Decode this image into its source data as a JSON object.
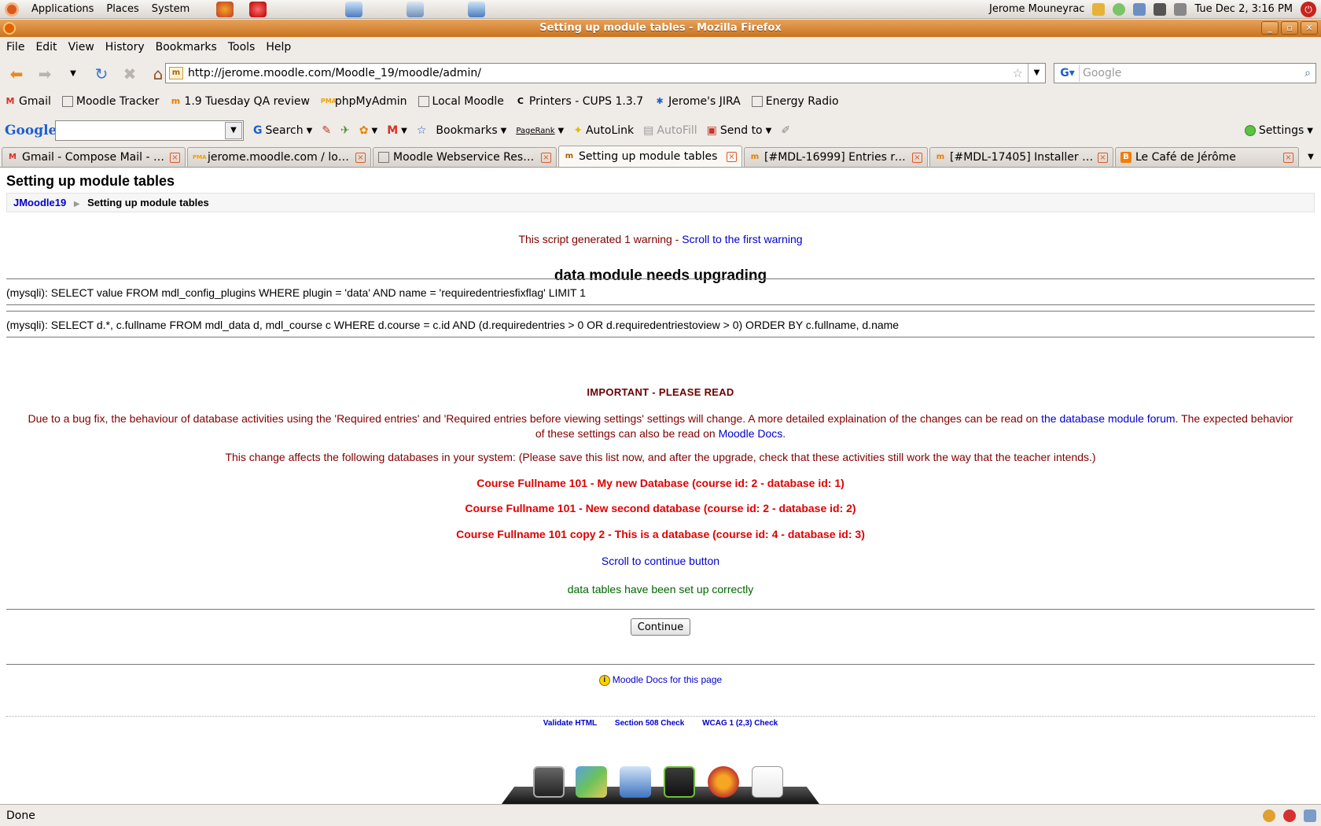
{
  "panel": {
    "menus": [
      "Applications",
      "Places",
      "System"
    ],
    "user": "Jerome Mouneyrac",
    "datetime": "Tue Dec  2,  3:16 PM"
  },
  "window": {
    "title": "Setting up module tables - Mozilla Firefox"
  },
  "menubar": [
    "File",
    "Edit",
    "View",
    "History",
    "Bookmarks",
    "Tools",
    "Help"
  ],
  "navigation": {
    "url": "http://jerome.moodle.com/Moodle_19/moodle/admin/",
    "search_placeholder": "Google"
  },
  "bookmarks": [
    "Gmail",
    "Moodle Tracker",
    "1.9 Tuesday QA review",
    "phpMyAdmin",
    "Local Moodle",
    "Printers - CUPS 1.3.7",
    "Jerome's JIRA",
    "Energy Radio"
  ],
  "google_toolbar": {
    "logo": "Google",
    "search_label": "Search",
    "bookmarks_label": "Bookmarks",
    "pagerank_label": "PageRank",
    "autolink_label": "AutoLink",
    "autofill_label": "AutoFill",
    "sendto_label": "Send to",
    "settings_label": "Settings"
  },
  "tabs": [
    {
      "label": "Gmail - Compose Mail - m...",
      "active": false
    },
    {
      "label": "jerome.moodle.com / local...",
      "active": false
    },
    {
      "label": "Moodle Webservice Rest T...",
      "active": false
    },
    {
      "label": "Setting up module tables",
      "active": true
    },
    {
      "label": "[#MDL-16999] Entries req...",
      "active": false
    },
    {
      "label": "[#MDL-17405] Installer br...",
      "active": false
    },
    {
      "label": "Le Café de Jérôme",
      "active": false
    }
  ],
  "page": {
    "heading": "Setting up module tables",
    "breadcrumb": {
      "root": "JMoodle19",
      "current": "Setting up module tables"
    },
    "warning_text": "This script generated 1 warning - ",
    "warning_link": "Scroll to the first warning",
    "upgrade_title": "data module needs upgrading",
    "sql": [
      "(mysqli): SELECT value FROM mdl_config_plugins WHERE plugin = 'data' AND name = 'requiredentriesfixflag' LIMIT 1",
      "(mysqli): SELECT d.*, c.fullname FROM mdl_data d, mdl_course c WHERE d.course = c.id AND (d.requiredentries > 0 OR d.requiredentriestoview > 0) ORDER BY c.fullname, d.name"
    ],
    "important": "IMPORTANT - PLEASE READ",
    "note_part1": "Due to a bug fix, the behaviour of database activities using the 'Required entries' and 'Required entries before viewing settings' settings will change. A more detailed explaination of the changes can be read on ",
    "note_link1": "the database module forum",
    "note_part2": ". The expected behavior of these settings can also be read on ",
    "note_link2": "Moodle Docs",
    "note_part3": ".",
    "affects": "This change affects the following databases in your system: (Please save this list now, and after the upgrade, check that these activities still work the way that the teacher intends.)",
    "databases": [
      "Course Fullname 101 - My new Database (course id: 2 - database id: 1)",
      "Course Fullname 101 - New second database (course id: 2 - database id: 2)",
      "Course Fullname 101 copy 2 - This is a database (course id: 4 - database id: 3)"
    ],
    "scroll_continue": "Scroll to continue button",
    "success": "data tables have been set up correctly",
    "continue_button": "Continue",
    "docs_link": "Moodle Docs for this page",
    "validators": [
      "Validate HTML",
      "Section 508 Check",
      "WCAG 1 (2,3) Check"
    ]
  },
  "status": {
    "text": "Done"
  }
}
